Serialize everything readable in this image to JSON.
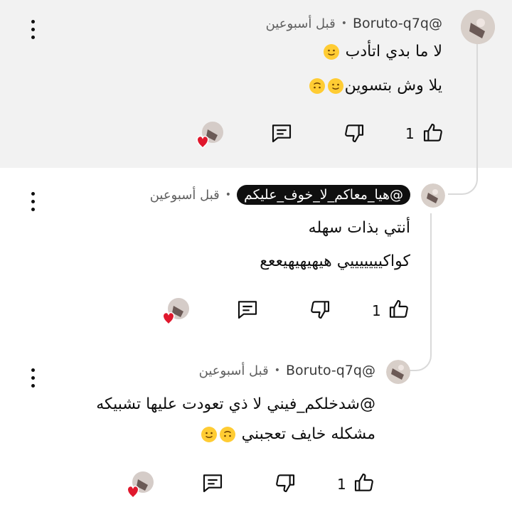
{
  "comments": [
    {
      "handle": "@Boruto-q7q",
      "time": "قبل أسبوعين",
      "lines": [
        "لا ما بدي اتأدب",
        "يلا وش بتسوين"
      ],
      "likes": "1"
    },
    {
      "handle": "@هيا_معاكم_لا_خوف_عليكم",
      "time": "قبل أسبوعين",
      "lines": [
        "أنتي بذات سهله",
        "كواكيييييييي هيهيهيهيععع"
      ],
      "likes": "1"
    },
    {
      "handle": "@Boruto-q7q",
      "time": "قبل أسبوعين",
      "lines": [
        "@شدخلكم_فيني لا ذي تعودت عليها تشبيكه",
        "مشكله خايف تعجبني"
      ],
      "likes": "1"
    }
  ],
  "separator": "•",
  "icons": {
    "like": "thumb-up-icon",
    "dislike": "thumb-down-icon",
    "reply": "reply-comment-icon",
    "more": "more-vertical-icon",
    "heart": "creator-heart-icon"
  },
  "colors": {
    "highlight": "#f2f2f2",
    "heart": "#e0182d",
    "pill": "#0f0f0f"
  }
}
